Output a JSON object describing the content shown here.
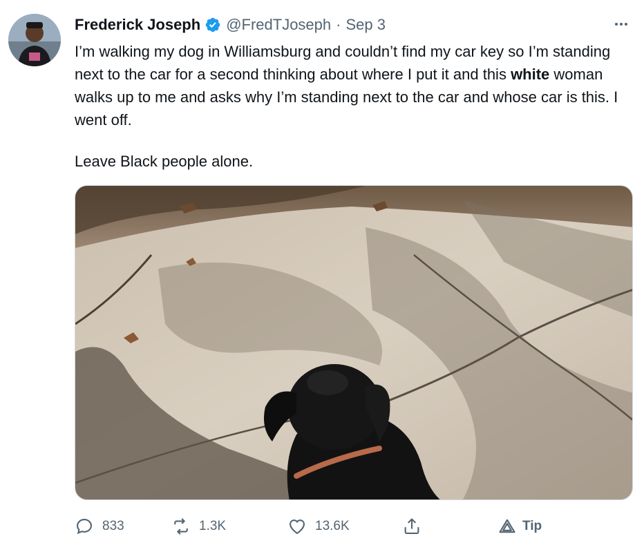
{
  "tweet": {
    "author_name": "Frederick Joseph",
    "handle": "@FredTJoseph",
    "separator": "·",
    "date": "Sep 3",
    "text_part1": "I’m walking my dog in Williamsburg and couldn’t find my car key so I’m standing next to the car for a second thinking about where I put it and this ",
    "text_bold": "white",
    "text_part2": " woman walks up to me and asks why I’m standing next to the car and whose car is this. I went off.",
    "text_line2": "Leave Black people alone."
  },
  "media": {
    "description": "Photo of a black dog on a sidewalk with shadows"
  },
  "actions": {
    "replies": "833",
    "retweets": "1.3K",
    "likes": "13.6K",
    "tip_label": "Tip"
  },
  "icons": {
    "verified": "verified-badge-icon",
    "more": "more-dots-icon",
    "reply": "reply-icon",
    "retweet": "retweet-icon",
    "like": "heart-icon",
    "share": "share-icon",
    "tip": "tip-icon"
  },
  "colors": {
    "verified_blue": "#1d9bf0",
    "secondary_text": "#536471",
    "primary_text": "#0f1419"
  }
}
